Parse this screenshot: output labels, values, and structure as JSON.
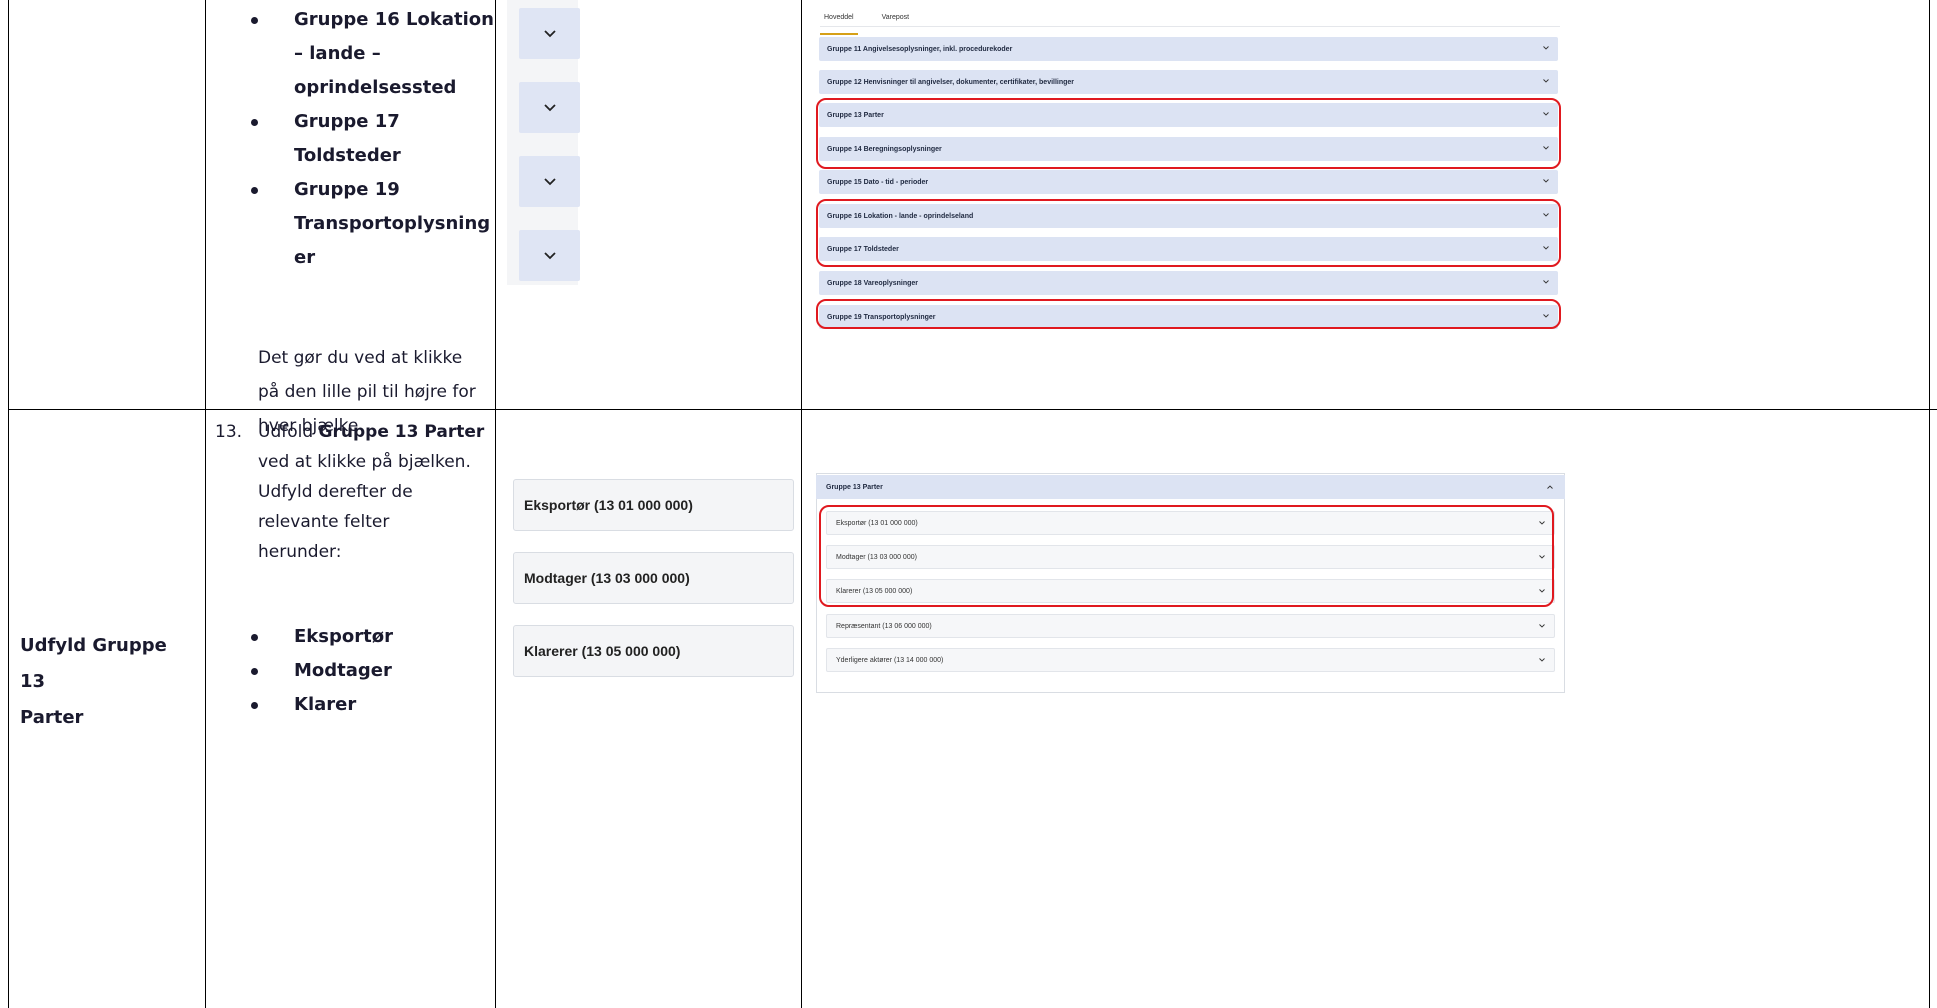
{
  "row1": {
    "bullets": [
      "Gruppe 16 Lokation",
      "– lande –",
      "oprindelsessted",
      "Gruppe 17",
      "Toldsteder",
      "Gruppe 19",
      "Transportoplysning",
      "er"
    ],
    "note_lines": [
      "Det gør du ved at klikke",
      "på den lille pil til højre for",
      "hver bjælke"
    ]
  },
  "screen1": {
    "tabs": [
      "Hoveddel",
      "Varepost"
    ],
    "groups": [
      "Gruppe 11 Angivelsesoplysninger, inkl. procedurekoder",
      "Gruppe 12 Henvisninger til angivelser, dokumenter, certifikater, bevillinger",
      "Gruppe 13 Parter",
      "Gruppe 14 Beregningsoplysninger",
      "Gruppe 15 Dato - tid - perioder",
      "Gruppe 16 Lokation - lande - oprindelseland",
      "Gruppe 17 Toldsteder",
      "Gruppe 18 Vareoplysninger",
      "Gruppe 19 Transportoplysninger"
    ]
  },
  "row2": {
    "label_lines": [
      "Udfyld Gruppe 13",
      "Parter"
    ],
    "step_number": "13.",
    "step_lines": {
      "l1_pre": "Udfold ",
      "l1_bold": "Gruppe 13 Parter",
      "l2": "ved at klikke på bjælken.",
      "l3": "Udfyld derefter de",
      "l4": "relevante felter",
      "l5": "herunder:"
    },
    "bullets": [
      "Eksportør",
      "Modtager",
      "Klarer"
    ],
    "fields": [
      "Eksportør (13 01 000 000)",
      "Modtager (13 03 000 000)",
      "Klarerer (13 05 000 000)"
    ]
  },
  "screen2": {
    "header": "Gruppe 13 Parter",
    "items": [
      "Eksportør (13 01 000 000)",
      "Modtager (13 03 000 000)",
      "Klarerer (13 05 000 000)",
      "Repræsentant (13 06 000 000)",
      "Yderligere aktører (13 14 000 000)"
    ]
  },
  "colors": {
    "highlight": "#e0191f",
    "bar": "#dce3f3",
    "tab_accent": "#d6a017"
  }
}
